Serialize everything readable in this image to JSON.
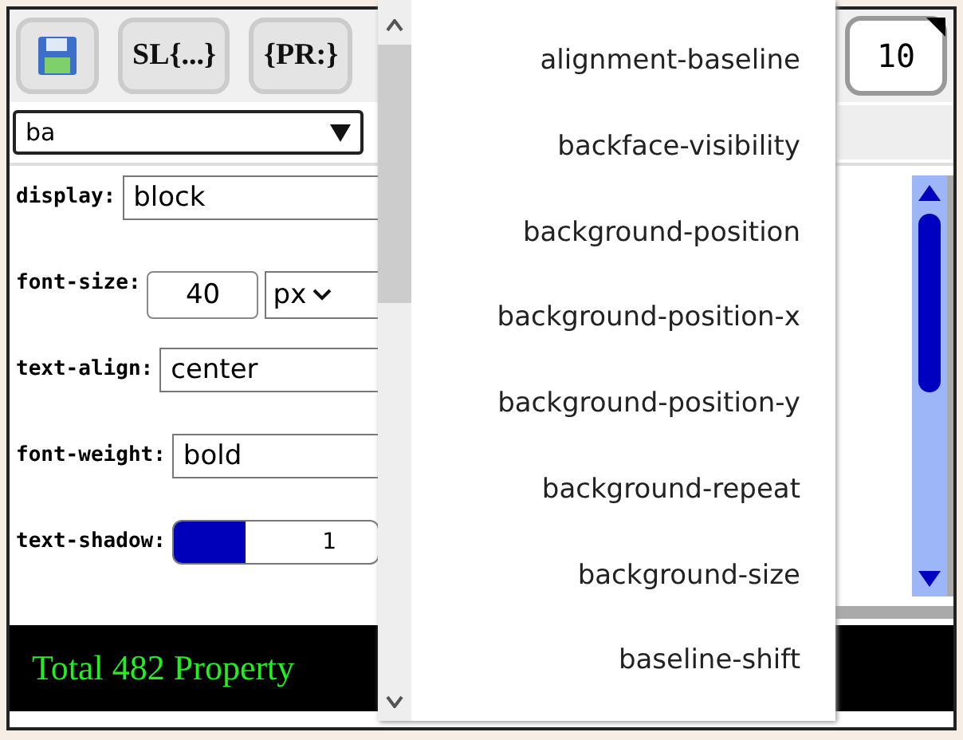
{
  "toolbar": {
    "buttons": [
      {
        "kind": "save"
      },
      {
        "kind": "text",
        "label": "SL{...}"
      },
      {
        "kind": "text",
        "label": "{PR:}"
      }
    ],
    "counter": "10"
  },
  "search": {
    "value": "ba"
  },
  "properties": [
    {
      "kind": "text",
      "name": "display:",
      "value": "block"
    },
    {
      "kind": "unit",
      "name": "font-size:",
      "value": "40",
      "unit": "px"
    },
    {
      "kind": "text",
      "name": "text-align:",
      "value": "center"
    },
    {
      "kind": "text",
      "name": "font-weight:",
      "value": "bold"
    },
    {
      "kind": "slider",
      "name": "text-shadow:",
      "level": 0.35,
      "reading": "1"
    }
  ],
  "status_bar": {
    "text": "Total 482 Property"
  },
  "dropdown": {
    "items": [
      "alignment-baseline",
      "backface-visibility",
      "background-position",
      "background-position-x",
      "background-position-y",
      "background-repeat",
      "background-size",
      "baseline-shift"
    ]
  }
}
